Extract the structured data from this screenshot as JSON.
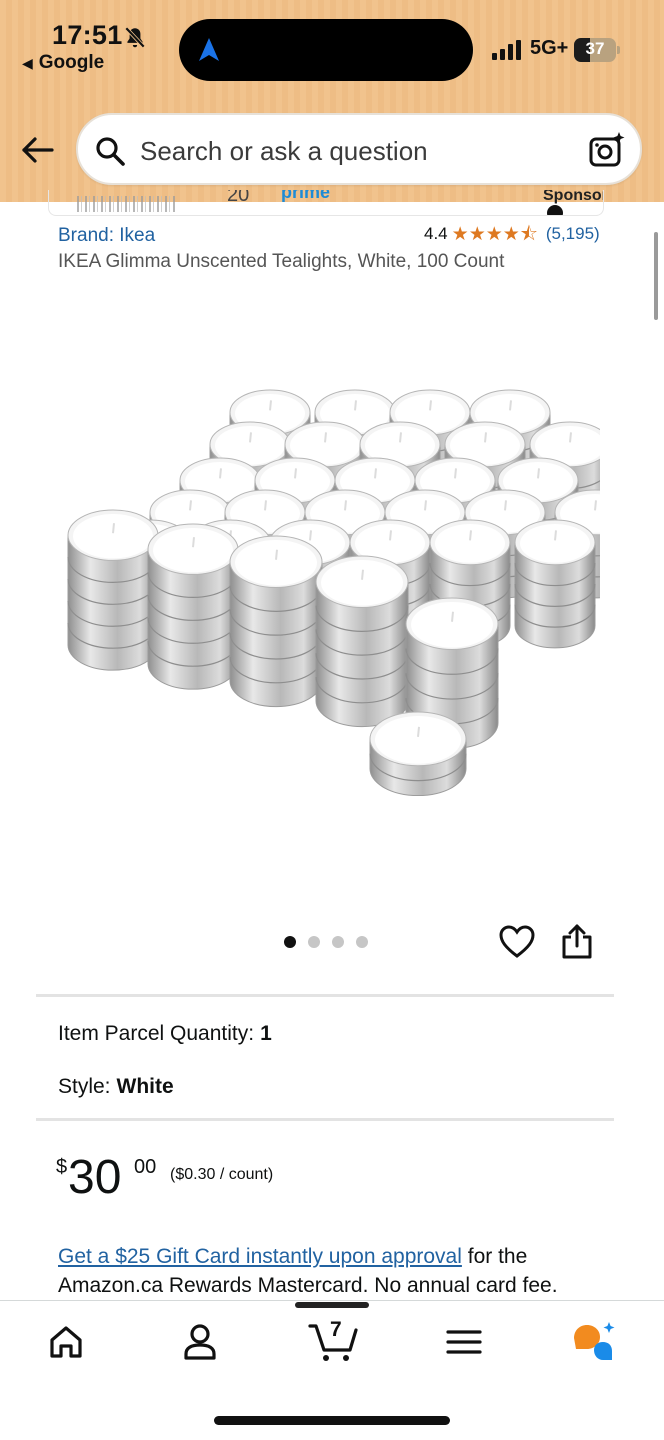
{
  "status_bar": {
    "time": "17:51",
    "back_app": "Google",
    "network": "5G+",
    "battery": "37",
    "battery_level": 0.37
  },
  "search": {
    "placeholder": "Search or ask a question"
  },
  "sponsored": {
    "partial_text": "20",
    "prime_text": "prime",
    "label": "Sponsored"
  },
  "product": {
    "brand": "Brand: Ikea",
    "rating": "4.4",
    "rating_value": 4.4,
    "review_count": "(5,195)",
    "title": "IKEA Glimma Unscented Tealights, White, 100 Count",
    "image_count": 4,
    "active_image": 1
  },
  "attributes": {
    "quantity_label": "Item Parcel Quantity:",
    "quantity_value": "1",
    "style_label": "Style:",
    "style_value": "White"
  },
  "price": {
    "symbol": "$",
    "whole": "30",
    "fraction": "00",
    "unit_price": "($0.30 / count)"
  },
  "promo": {
    "link_text": "Get a $25 Gift Card instantly upon approval",
    "rest_text": " for the Amazon.ca Rewards Mastercard. No annual card fee."
  },
  "nav": {
    "cart_count": "7"
  }
}
